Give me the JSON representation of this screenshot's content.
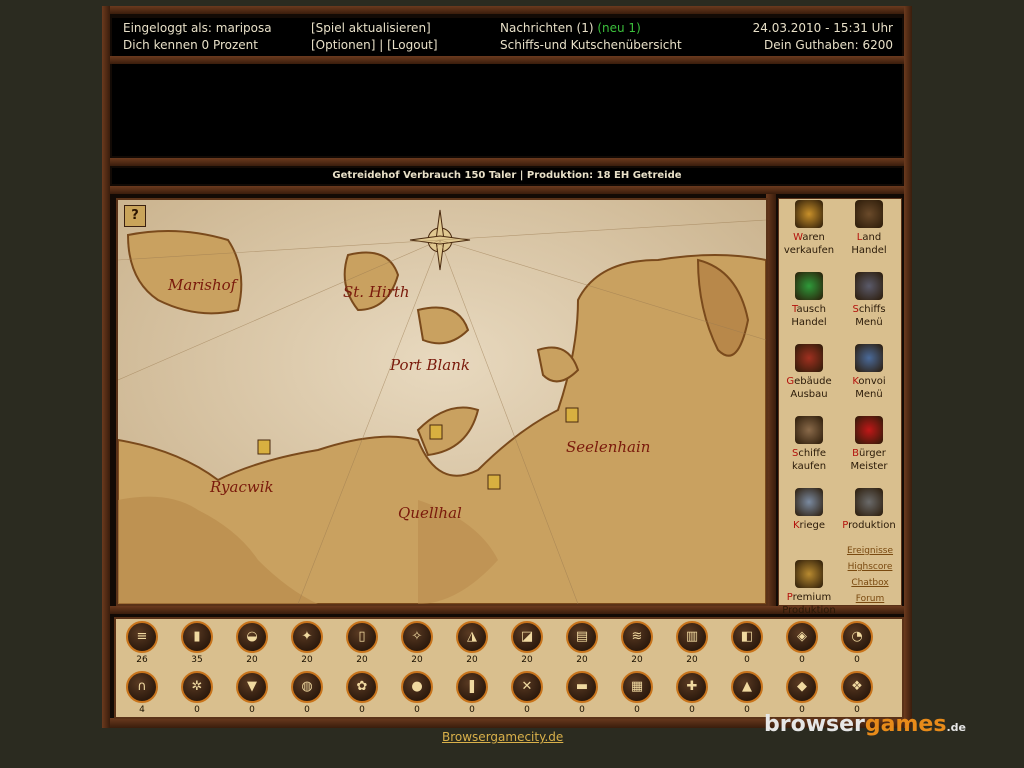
{
  "header": {
    "login_label": "Eingeloggt als: mariposa",
    "known_label": "Dich kennen 0 Prozent",
    "refresh_link": "[Spiel aktualisieren]",
    "options_link": "[Optionen]",
    "separator": "|",
    "logout_link": "[Logout]",
    "messages_link": "Nachrichten (1)",
    "messages_new": "(neu 1)",
    "overview_link": "Schiffs-und Kutschenübersicht",
    "datetime": "24.03.2010 - 15:31 Uhr",
    "balance": "Dein Guthaben:  6200"
  },
  "infobar": "Getreidehof Verbrauch 150 Taler | Produktion: 18 EH Getreide",
  "map": {
    "help": "?",
    "towns": [
      "Marishof",
      "St. Hirth",
      "Port Blank",
      "Ryacwik",
      "Quellhal",
      "Seelenhain"
    ]
  },
  "menu": [
    {
      "first": "W",
      "rest": "aren",
      "line2": "verkaufen"
    },
    {
      "first": "L",
      "rest": "and",
      "line2": "Handel"
    },
    {
      "first": "T",
      "rest": "ausch",
      "line2": "Handel"
    },
    {
      "first": "S",
      "rest": "chiffs",
      "line2": "Menü"
    },
    {
      "first": "G",
      "rest": "ebäude",
      "line2": "Ausbau"
    },
    {
      "first": "K",
      "rest": "onvoi",
      "line2": "Menü"
    },
    {
      "first": "S",
      "rest": "chiffe",
      "line2": "kaufen"
    },
    {
      "first": "B",
      "rest": "ürger",
      "line2": "Meister"
    },
    {
      "first": "K",
      "rest": "riege",
      "line2": ""
    },
    {
      "first": "P",
      "rest": "roduktion",
      "line2": ""
    },
    {
      "first": "P",
      "rest": "remium",
      "line2": "Produktion"
    }
  ],
  "side_links": [
    "Ereignisse",
    "Highscore",
    "Chatbox",
    "Forum"
  ],
  "resources_row1": [
    "26",
    "35",
    "20",
    "20",
    "20",
    "20",
    "20",
    "20",
    "20",
    "20",
    "20",
    "0",
    "0",
    "0"
  ],
  "resources_row2": [
    "4",
    "0",
    "0",
    "0",
    "0",
    "0",
    "0",
    "0",
    "0",
    "0",
    "0",
    "0",
    "0",
    "0"
  ],
  "footer_link": "Browsergamecity.de",
  "logo": {
    "a": "browser",
    "b": "games",
    "c": ".de"
  }
}
